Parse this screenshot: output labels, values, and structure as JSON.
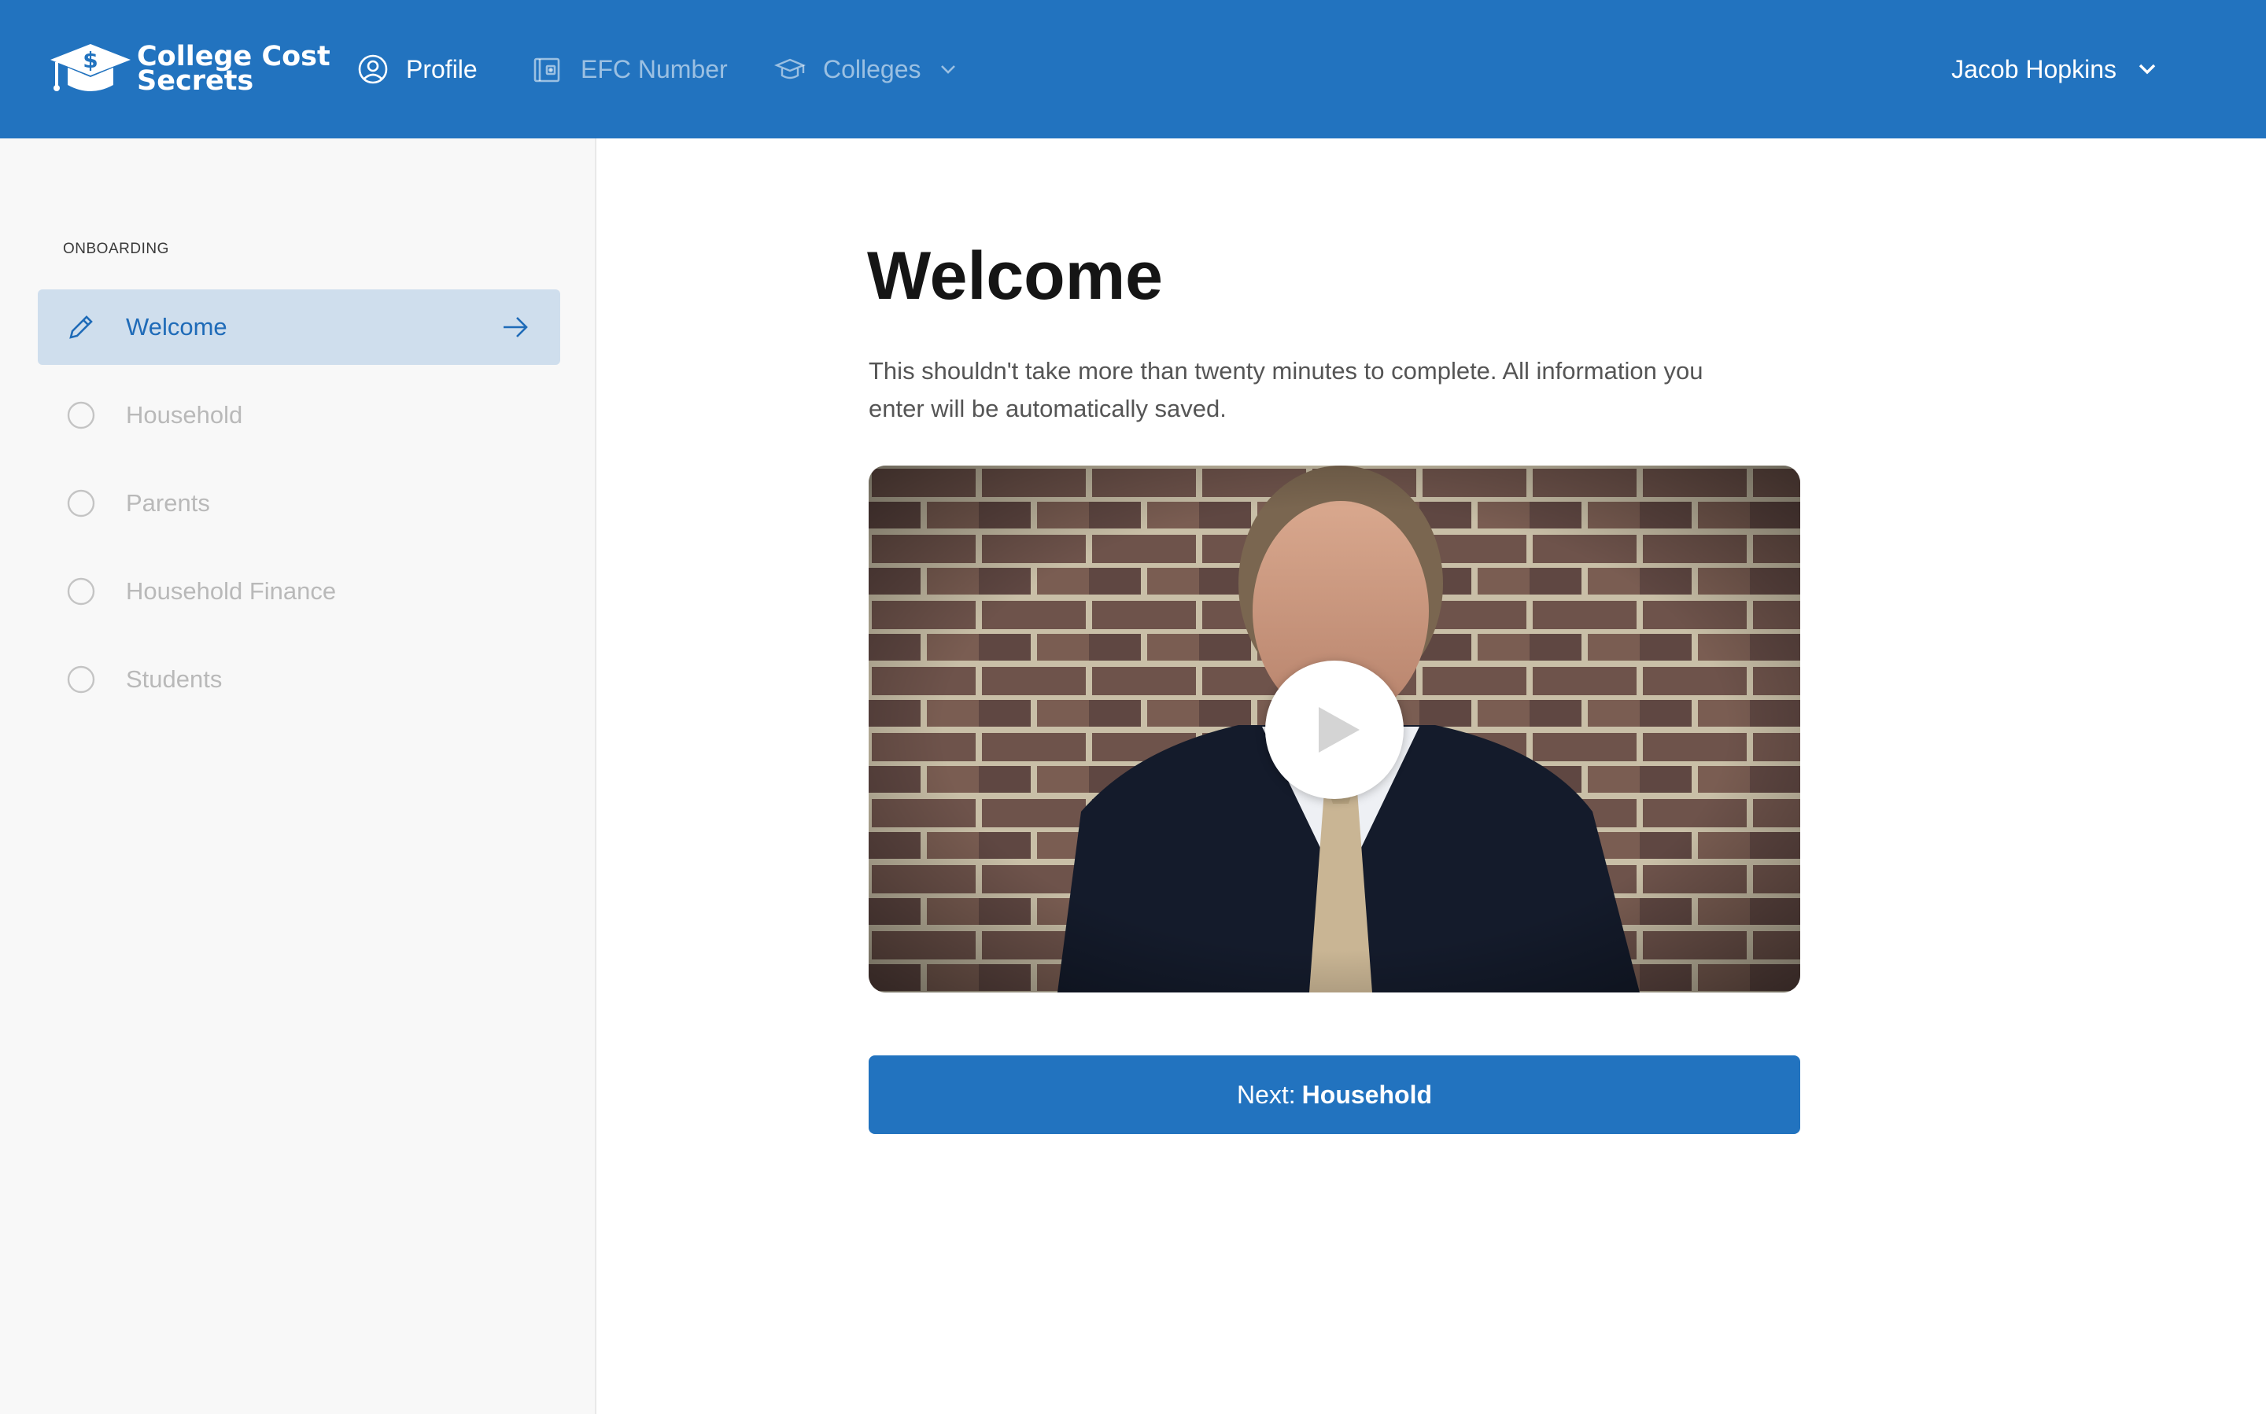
{
  "brand": {
    "line1": "College Cost",
    "line2": "Secrets",
    "logo_icon": "graduation-cap-dollar-icon"
  },
  "nav": [
    {
      "label": "Profile",
      "icon": "user-circle-icon",
      "active": true
    },
    {
      "label": "EFC Number",
      "icon": "wallet-icon",
      "active": false
    },
    {
      "label": "Colleges",
      "icon": "graduation-cap-icon",
      "active": false,
      "dropdown": true
    }
  ],
  "user": {
    "name": "Jacob Hopkins"
  },
  "sidebar": {
    "section_label": "ONBOARDING",
    "steps": [
      {
        "label": "Welcome",
        "icon": "pencil-icon",
        "active": true
      },
      {
        "label": "Household",
        "icon": "circle-icon",
        "active": false
      },
      {
        "label": "Parents",
        "icon": "circle-icon",
        "active": false
      },
      {
        "label": "Household Finance",
        "icon": "circle-icon",
        "active": false
      },
      {
        "label": "Students",
        "icon": "circle-icon",
        "active": false
      }
    ]
  },
  "main": {
    "title": "Welcome",
    "intro": "This shouldn't take more than twenty minutes to complete. All information you enter will be automatically saved.",
    "next_prefix": "Next:",
    "next_target": "Household"
  },
  "colors": {
    "primary": "#2273bf",
    "active_step_bg": "#cfdeed",
    "active_step_text": "#1f6bb8"
  }
}
